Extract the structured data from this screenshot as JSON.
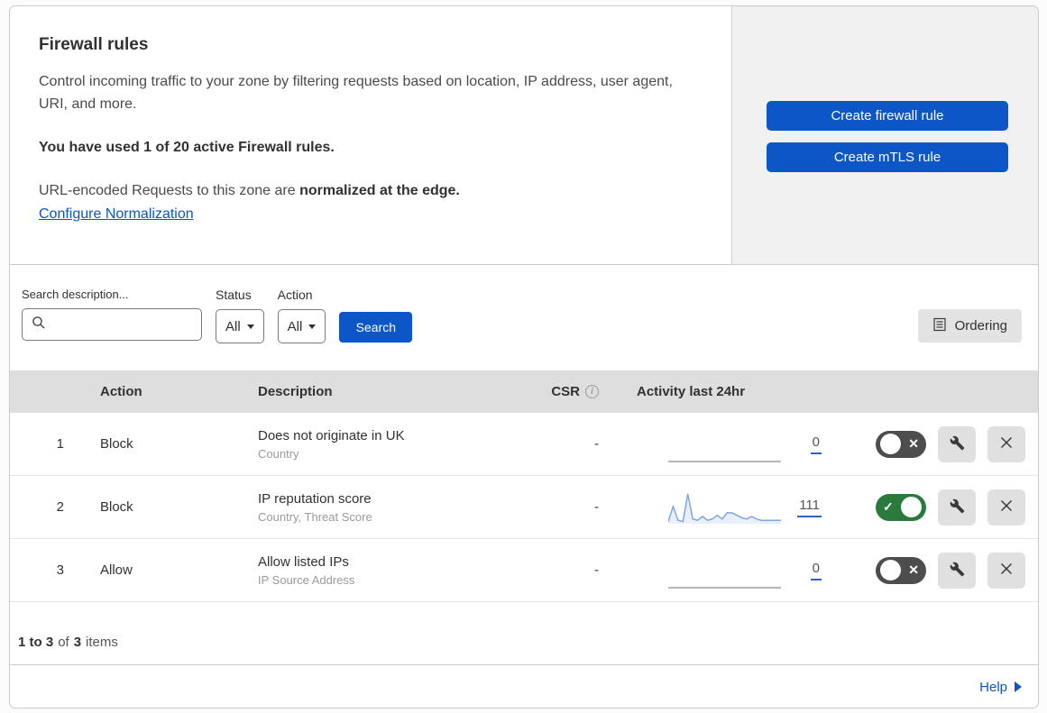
{
  "header": {
    "title": "Firewall rules",
    "description": "Control incoming traffic to your zone by filtering requests based on location, IP address, user agent, URI, and more.",
    "usage_bold": "You have used 1 of 20 active Firewall rules.",
    "normalization_prefix": "URL-encoded Requests to this zone are ",
    "normalization_bold": "normalized at the edge.",
    "normalization_link": "Configure Normalization",
    "create_firewall_button": "Create firewall rule",
    "create_mtls_button": "Create mTLS rule"
  },
  "filters": {
    "search_label": "Search description...",
    "search_value": "",
    "status_label": "Status",
    "status_value": "All",
    "action_label": "Action",
    "action_value": "All",
    "search_button": "Search",
    "ordering_button": "Ordering"
  },
  "table": {
    "columns": {
      "action": "Action",
      "description": "Description",
      "csr": "CSR",
      "activity": "Activity last 24hr"
    },
    "rows": [
      {
        "priority": "1",
        "action": "Block",
        "description": "Does not originate in UK",
        "fields": "Country",
        "csr": "-",
        "activity_count": "0",
        "enabled": false,
        "has_sparkline": false
      },
      {
        "priority": "2",
        "action": "Block",
        "description": "IP reputation score",
        "fields": "Country, Threat Score",
        "csr": "-",
        "activity_count": "111",
        "enabled": true,
        "has_sparkline": true
      },
      {
        "priority": "3",
        "action": "Allow",
        "description": "Allow listed IPs",
        "fields": "IP Source Address",
        "csr": "-",
        "activity_count": "0",
        "enabled": false,
        "has_sparkline": false
      }
    ]
  },
  "footer": {
    "range_bold": "1 to 3",
    "of_text": "of",
    "total_bold": "3",
    "items_text": "items",
    "help_link": "Help"
  },
  "icons": {
    "search_icon": "magnifier",
    "dropdown_icon": "caret-down",
    "ordering_icon": "list-document",
    "info_icon": "circled-i",
    "edit_icon": "wrench",
    "delete_icon": "x-cross",
    "toggle_off_icon": "x-cross",
    "toggle_on_icon": "checkmark",
    "help_icon": "right-triangle"
  },
  "colors": {
    "primary_blue": "#0d56c7",
    "link_blue": "#0b55c5",
    "toggle_on_green": "#2b7a3d",
    "toggle_off_gray": "#4d4d4d",
    "table_header_bg": "#dedede",
    "side_panel_bg": "#f1f1f1",
    "icon_button_bg": "#e0e0e0",
    "sparkline_stroke": "#7aa6e8",
    "sparkline_fill": "#eaf0fb",
    "count_underline": "#2f62c4"
  },
  "chart_data": {
    "type": "area",
    "title": "Activity last 24hr sparkline (rule 2: IP reputation score)",
    "x_range_hours": 24,
    "values": [
      1,
      13,
      2,
      1,
      23,
      3,
      2,
      5,
      2,
      3,
      6,
      3,
      8,
      8,
      6,
      4,
      3,
      5,
      3,
      2,
      2,
      2,
      2,
      2
    ],
    "total": 111,
    "axes_hidden": true,
    "legend": "none",
    "other_rows": [
      {
        "rule": "1",
        "total": 0
      },
      {
        "rule": "3",
        "total": 0
      }
    ]
  }
}
